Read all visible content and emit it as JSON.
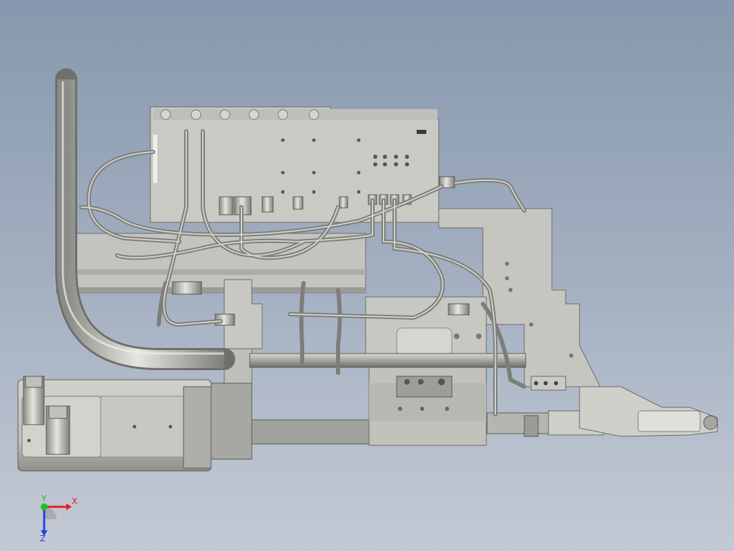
{
  "viewport": {
    "background_top": "#8797ad",
    "background_bottom": "#c4cad4",
    "model_color": "#c9c9c2",
    "shadow_color": "#8c8c86",
    "edge_color": "#505050"
  },
  "triad": {
    "x_label": "X",
    "y_label": "Y",
    "z_label": "Z",
    "x_color": "#e02020",
    "y_color": "#20c020",
    "z_color": "#2040e0"
  }
}
